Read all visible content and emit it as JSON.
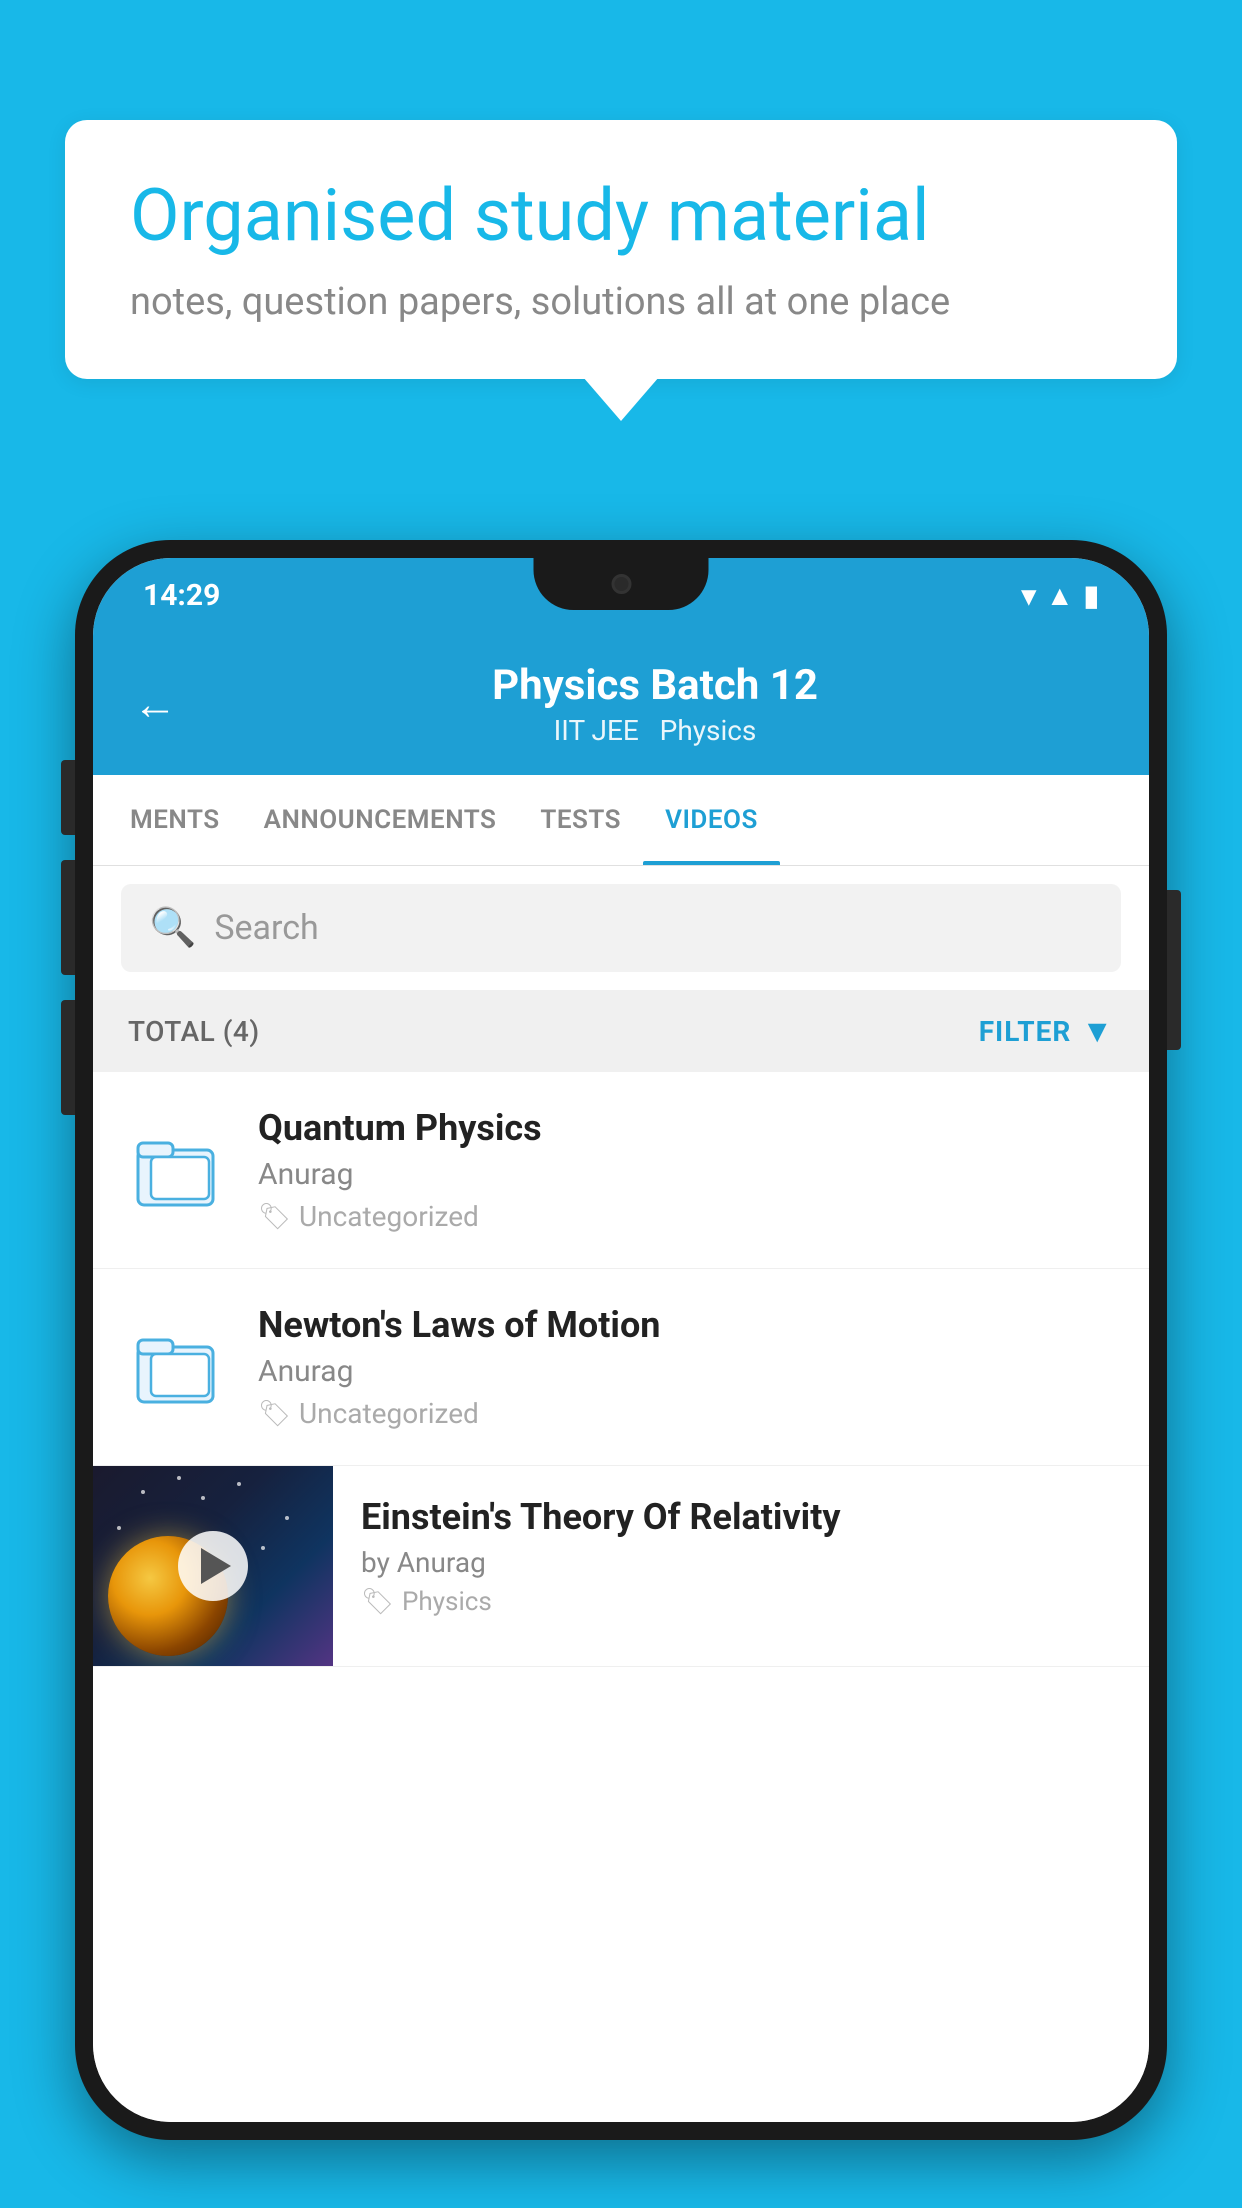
{
  "background_color": "#18b8e8",
  "speech_bubble": {
    "title": "Organised study material",
    "subtitle": "notes, question papers, solutions all at one place"
  },
  "status_bar": {
    "time": "14:29",
    "icons": [
      "wifi",
      "signal",
      "battery"
    ]
  },
  "app_header": {
    "back_label": "←",
    "title": "Physics Batch 12",
    "subtitle_parts": [
      "IIT JEE",
      "Physics"
    ]
  },
  "tabs": [
    {
      "label": "MENTS",
      "active": false
    },
    {
      "label": "ANNOUNCEMENTS",
      "active": false
    },
    {
      "label": "TESTS",
      "active": false
    },
    {
      "label": "VIDEOS",
      "active": true
    }
  ],
  "search": {
    "placeholder": "Search"
  },
  "filter_bar": {
    "total_label": "TOTAL (4)",
    "filter_label": "FILTER"
  },
  "list_items": [
    {
      "type": "folder",
      "title": "Quantum Physics",
      "author": "Anurag",
      "tag": "Uncategorized"
    },
    {
      "type": "folder",
      "title": "Newton's Laws of Motion",
      "author": "Anurag",
      "tag": "Uncategorized"
    },
    {
      "type": "video",
      "title": "Einstein's Theory Of Relativity",
      "author": "by Anurag",
      "tag": "Physics"
    }
  ]
}
